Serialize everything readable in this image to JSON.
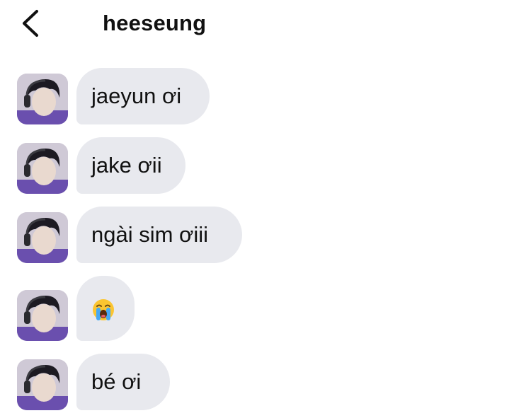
{
  "header": {
    "title": "heeseung",
    "back_icon": "chevron-left-icon"
  },
  "messages": [
    {
      "text": "jaeyun ơi",
      "type": "text"
    },
    {
      "text": "jake ơii",
      "type": "text"
    },
    {
      "text": "ngài sim ơiii",
      "type": "text"
    },
    {
      "text": "😭",
      "type": "emoji",
      "emoji_name": "loudly-crying-face-icon"
    },
    {
      "text": "bé ơi",
      "type": "text"
    }
  ],
  "colors": {
    "bubble": "#e8e9ee",
    "text": "#111111",
    "background": "#ffffff"
  }
}
